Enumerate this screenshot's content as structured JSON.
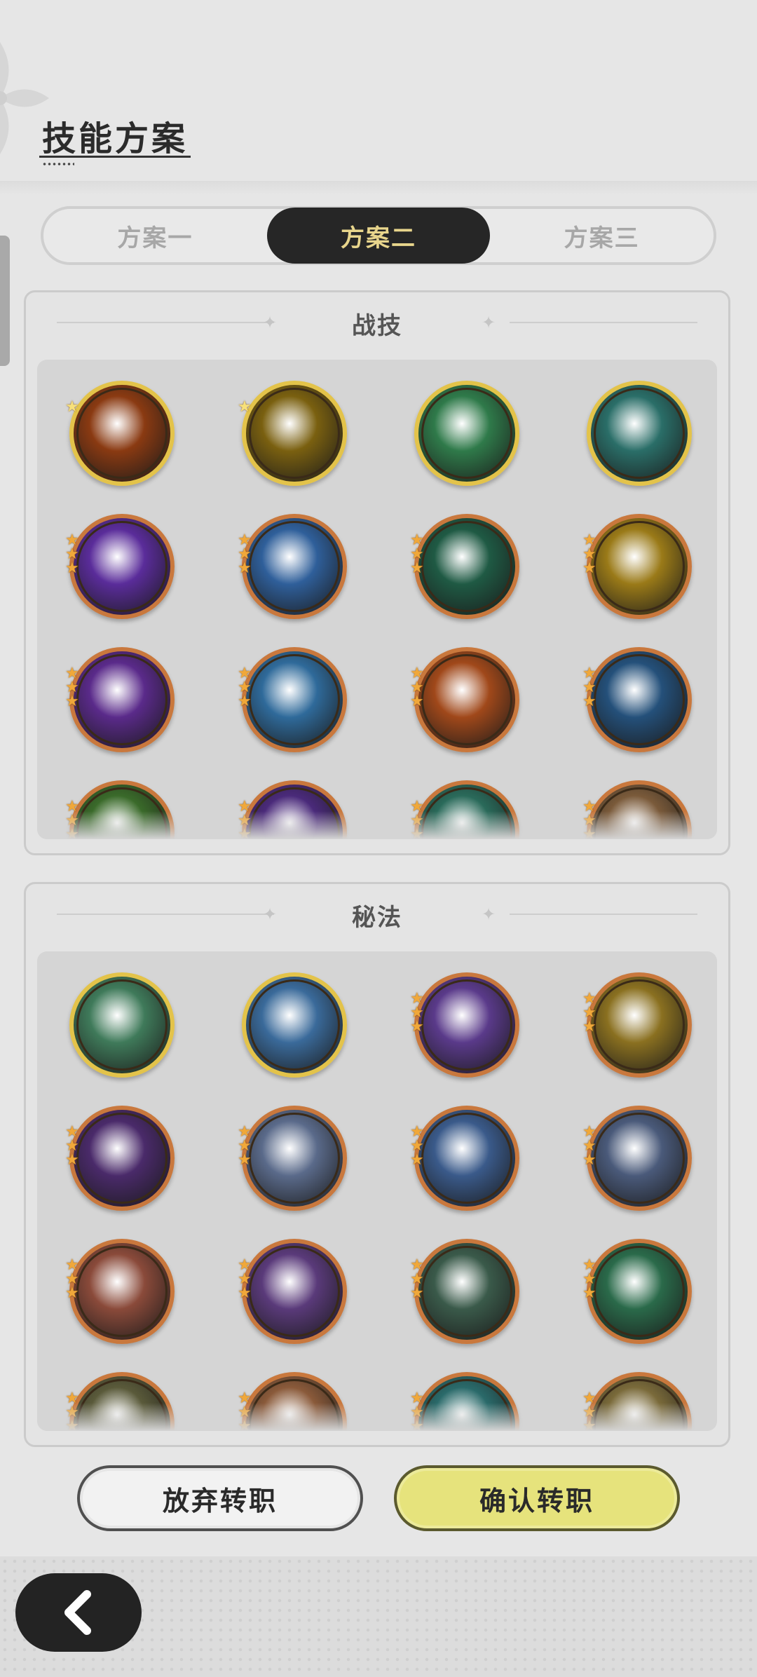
{
  "title": "技能方案",
  "tabs": [
    {
      "label": "方案一",
      "active": false
    },
    {
      "label": "方案二",
      "active": true
    },
    {
      "label": "方案三",
      "active": false
    }
  ],
  "sections": {
    "battle": {
      "title": "战技",
      "skills": [
        {
          "icon": "fire-swirl-icon",
          "rarity": 1,
          "frame": "gold",
          "color": "#8a3a12"
        },
        {
          "icon": "golden-crystal-icon",
          "rarity": 1,
          "frame": "gold",
          "color": "#7a6010"
        },
        {
          "icon": "green-slash-icon",
          "rarity": 0,
          "frame": "gold",
          "color": "#2f7a4a"
        },
        {
          "icon": "teal-vortex-icon",
          "rarity": 0,
          "frame": "gold",
          "color": "#2a6e68"
        },
        {
          "icon": "purple-orb-icon",
          "rarity": 3,
          "frame": "copper",
          "color": "#5a2c9a"
        },
        {
          "icon": "blue-flame-icon",
          "rarity": 3,
          "frame": "copper",
          "color": "#2f5f9a"
        },
        {
          "icon": "thorn-vine-icon",
          "rarity": 3,
          "frame": "copper",
          "color": "#1f5a44"
        },
        {
          "icon": "gold-sparkle-icon",
          "rarity": 3,
          "frame": "copper",
          "color": "#9a7a18"
        },
        {
          "icon": "void-eye-icon",
          "rarity": 3,
          "frame": "copper",
          "color": "#5a2a8a"
        },
        {
          "icon": "ice-shard-icon",
          "rarity": 3,
          "frame": "copper",
          "color": "#2f6a9a"
        },
        {
          "icon": "fire-burst-icon",
          "rarity": 3,
          "frame": "copper",
          "color": "#a0481a"
        },
        {
          "icon": "frost-spike-icon",
          "rarity": 3,
          "frame": "copper",
          "color": "#24507a"
        },
        {
          "icon": "green-beast-icon",
          "rarity": 3,
          "frame": "copper",
          "color": "#3a6a2a"
        },
        {
          "icon": "purple-shadow-icon",
          "rarity": 3,
          "frame": "copper",
          "color": "#4a2a7a"
        },
        {
          "icon": "teal-wind-icon",
          "rarity": 3,
          "frame": "copper",
          "color": "#2a6a5a"
        },
        {
          "icon": "sand-rock-icon",
          "rarity": 3,
          "frame": "copper",
          "color": "#7a5a3a"
        }
      ]
    },
    "secret": {
      "title": "秘法",
      "skills": [
        {
          "icon": "green-shield-icon",
          "rarity": 0,
          "frame": "gold",
          "color": "#3f7a5a"
        },
        {
          "icon": "ice-blade-icon",
          "rarity": 0,
          "frame": "gold",
          "color": "#3a6a9a"
        },
        {
          "icon": "purple-gem-icon",
          "rarity": 3,
          "frame": "copper",
          "color": "#5a3a8a"
        },
        {
          "icon": "gold-fist-icon",
          "rarity": 3,
          "frame": "copper",
          "color": "#8a7020"
        },
        {
          "icon": "purple-dragon-icon",
          "rarity": 3,
          "frame": "copper",
          "color": "#4a2a6a"
        },
        {
          "icon": "silver-armor-icon",
          "rarity": 3,
          "frame": "copper",
          "color": "#5a6a8a"
        },
        {
          "icon": "blue-figure-icon",
          "rarity": 3,
          "frame": "copper",
          "color": "#3a5a8a"
        },
        {
          "icon": "star-crystal-icon",
          "rarity": 3,
          "frame": "copper",
          "color": "#4a5a7a"
        },
        {
          "icon": "red-ember-icon",
          "rarity": 3,
          "frame": "copper",
          "color": "#8a4a3a"
        },
        {
          "icon": "violet-rune-icon",
          "rarity": 3,
          "frame": "copper",
          "color": "#5a3a7a"
        },
        {
          "icon": "green-stone-icon",
          "rarity": 3,
          "frame": "copper",
          "color": "#3a5a4a"
        },
        {
          "icon": "emerald-cog-icon",
          "rarity": 3,
          "frame": "copper",
          "color": "#2a6a4a"
        },
        {
          "icon": "earth-crown-icon",
          "rarity": 3,
          "frame": "copper",
          "color": "#5a5a3a"
        },
        {
          "icon": "bronze-orb-icon",
          "rarity": 3,
          "frame": "copper",
          "color": "#8a5a3a"
        },
        {
          "icon": "teal-eye-icon",
          "rarity": 3,
          "frame": "copper",
          "color": "#2a6a6a"
        },
        {
          "icon": "sunlit-spire-icon",
          "rarity": 3,
          "frame": "copper",
          "color": "#7a6a3a"
        }
      ]
    }
  },
  "buttons": {
    "abandon": "放弃转职",
    "confirm": "确认转职",
    "back_icon": "chevron-left-icon"
  },
  "colors": {
    "tab_active_bg": "#262626",
    "tab_active_text": "#e8d58c",
    "confirm_bg": "#e6e37c",
    "gold_frame": "#e3c34a",
    "copper_frame": "#c9783d"
  }
}
